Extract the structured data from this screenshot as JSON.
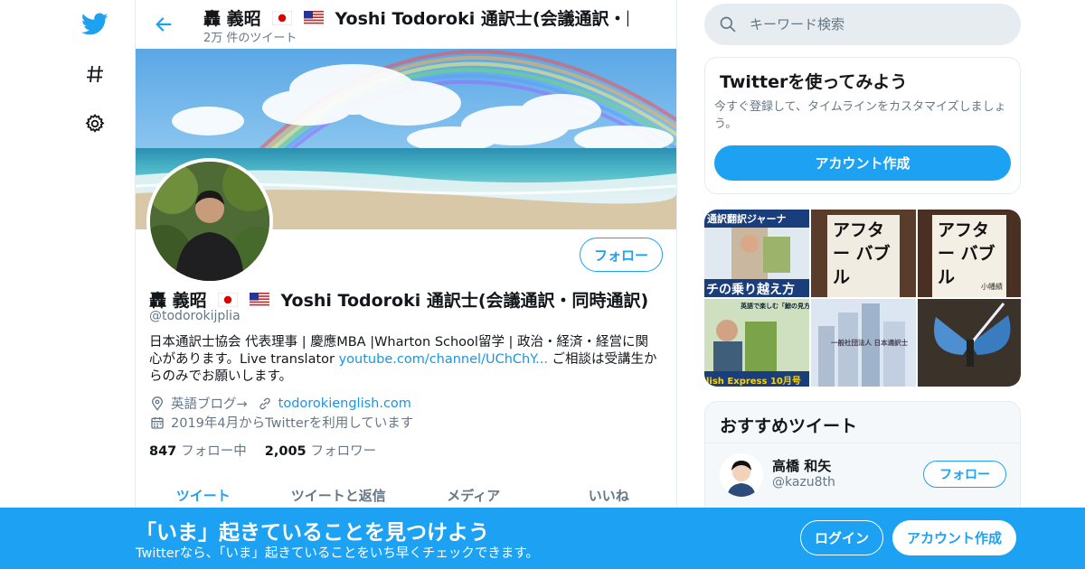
{
  "nav": {
    "icons": [
      "twitter-bird-icon",
      "hashtag-icon",
      "gear-icon"
    ]
  },
  "header": {
    "name_prefix": "轟 義昭",
    "name_suffix": "Yoshi Todoroki 通訳士(会議通訳・同…",
    "tweet_count": "2万 件のツイート"
  },
  "profile": {
    "follow_label": "フォロー",
    "name_prefix": "轟 義昭",
    "name_suffix": "Yoshi Todoroki 通訳士(会議通訳・同時通訳)",
    "handle": "@todorokijplia",
    "bio_part1": "日本通訳士協会 代表理事 | 慶應MBA |Wharton School留学 | 政治・経済・経営に関心があります。Live translator ",
    "bio_link": "youtube.com/channel/UChChY...",
    "bio_part2": " ご相談は受講生からのみでお願いします。",
    "location": "英語ブログ→",
    "website": "todorokienglish.com",
    "joined": "2019年4月からTwitterを利用しています",
    "following_count": "847",
    "following_label": "フォロー中",
    "followers_count": "2,005",
    "followers_label": "フォロワー"
  },
  "tabs": [
    "ツイート",
    "ツイートと返信",
    "メディア",
    "いいね"
  ],
  "search": {
    "placeholder": "キーワード検索"
  },
  "signup_card": {
    "title": "Twitterを使ってみよう",
    "desc": "今すぐ登録して、タイムラインをカスタマイズしましょう。",
    "button": "アカウント作成"
  },
  "media": {
    "tile1_top": "通訳翻訳ジャーナ",
    "tile1_bottom": "チの乗り越え方",
    "tile2_text": "アフター バブル",
    "tile3_text": "アフター バブル",
    "tile4_top": "英語で楽しむ「鯨の見方」",
    "tile4_bottom": "lish Express 10月号",
    "tile5_text": "一般社団法人 日本通訳士",
    "tile3_author": "小幡績"
  },
  "recommend": {
    "title": "おすすめツイート",
    "name": "高橋 和矢",
    "handle": "@kazu8th",
    "follow_label": "フォロー"
  },
  "bottom": {
    "title": "「いま」起きていることを見つけよう",
    "subtitle": "Twitterなら、「いま」起きていることをいち早くチェックできます。",
    "login": "ログイン",
    "signup": "アカウント作成"
  },
  "colors": {
    "accent": "#1da1f2",
    "link": "#1b95e0",
    "muted": "#657786",
    "border": "#e6ecf0"
  }
}
